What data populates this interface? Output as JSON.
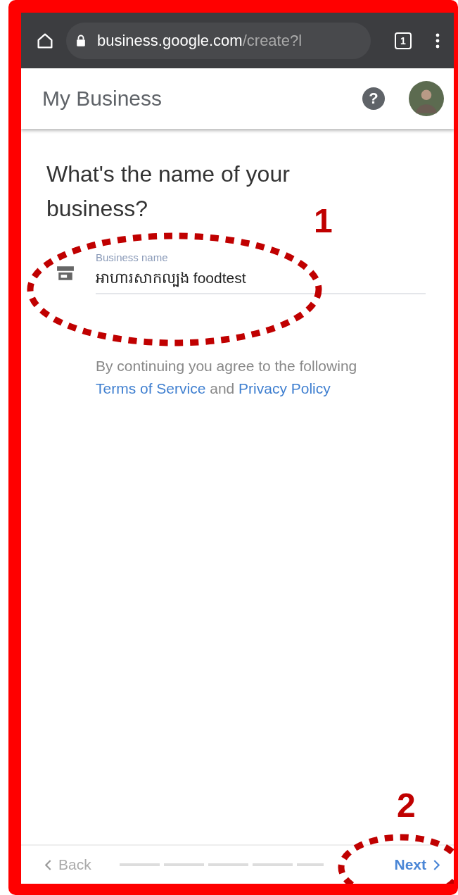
{
  "browser": {
    "url_host": "business.google.com",
    "url_path": "/create?l",
    "tab_count": "1"
  },
  "header": {
    "title": "My Business",
    "help_label": "?"
  },
  "form": {
    "heading": "What's the name of your business?",
    "field": {
      "label": "Business name",
      "value": "អាហារសាកល្បង foodtest"
    },
    "terms": {
      "before": "By continuing you agree to the following",
      "link1": "Terms of Service",
      "middle": "and",
      "link2": "Privacy Policy"
    }
  },
  "footer": {
    "back": "Back",
    "next": "Next"
  },
  "annotations": [
    {
      "label": "1"
    },
    {
      "label": "2"
    }
  ]
}
